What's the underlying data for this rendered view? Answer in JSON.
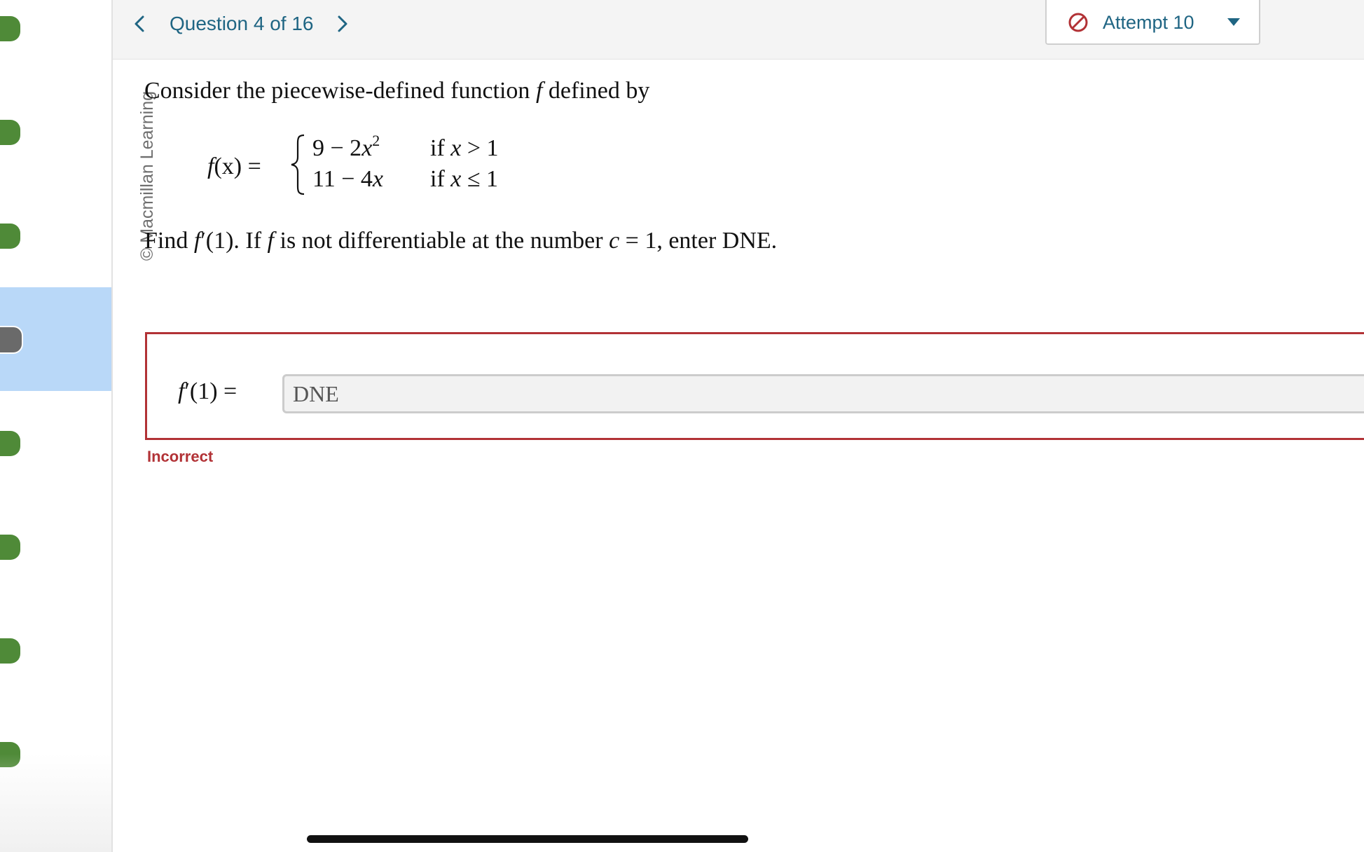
{
  "colors": {
    "accent": "#1f6583",
    "answered_dot": "#4f8a38",
    "current_dot": "#6a6a6a",
    "current_slot": "#b9d8f8",
    "error": "#b23236"
  },
  "rail": {
    "slots": [
      {
        "state": "answered"
      },
      {
        "state": "answered"
      },
      {
        "state": "answered"
      },
      {
        "state": "current"
      },
      {
        "state": "answered"
      },
      {
        "state": "answered"
      },
      {
        "state": "answered"
      },
      {
        "state": "answered"
      }
    ]
  },
  "header": {
    "prev_icon": "chevron-left-icon",
    "next_icon": "chevron-right-icon",
    "question_title": "Question 4 of 16",
    "attempt": {
      "icon": "no-entry-icon",
      "label": "Attempt 10",
      "caret_icon": "caret-down-icon"
    }
  },
  "copyright": "© Macmillan Learning",
  "question": {
    "intro_before": "Consider the piecewise-defined function ",
    "intro_var": "f",
    "intro_after": " defined by",
    "piecewise": {
      "lhs_f": "f",
      "lhs_rest": "(x) =",
      "case1_expr_a": "9 − 2",
      "case1_expr_var": "x",
      "case1_expr_sup": "2",
      "case1_cond_a": "if ",
      "case1_cond_var": "x",
      "case1_cond_b": " > 1",
      "case2_expr_a": "11 − 4",
      "case2_expr_var": "x",
      "case2_cond_a": "if ",
      "case2_cond_var": "x",
      "case2_cond_b": " ≤ 1"
    },
    "find": {
      "p1": "Find ",
      "f1": "f",
      "p2": "′(1). If ",
      "f2": "f",
      "p3": " is not differentiable at the number ",
      "c": "c",
      "p4": " = 1, enter DNE."
    }
  },
  "answer": {
    "label_f": "f",
    "label_rest": "′(1) =",
    "value": "DNE",
    "status": "Incorrect"
  }
}
